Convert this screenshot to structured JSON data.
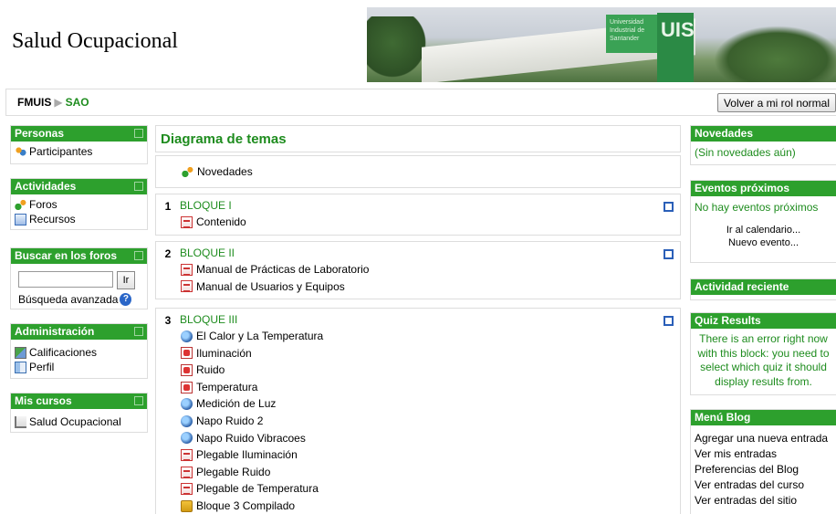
{
  "header": {
    "site_title": "Salud Ocupacional",
    "banner_sign": "Universidad Industrial de Santander",
    "banner_logo": "UIS"
  },
  "navbar": {
    "breadcrumb": [
      {
        "label": "FMUIS"
      },
      {
        "label": "SAO"
      }
    ],
    "separator": "▶",
    "role_button": "Volver a mi rol normal"
  },
  "left": {
    "personas": {
      "title": "Personas",
      "items": [
        {
          "label": "Participantes",
          "icon": "people-icon"
        }
      ]
    },
    "actividades": {
      "title": "Actividades",
      "items": [
        {
          "label": "Foros",
          "icon": "forum-icon"
        },
        {
          "label": "Recursos",
          "icon": "resource-icon"
        }
      ]
    },
    "buscar": {
      "title": "Buscar en los foros",
      "input_value": "",
      "button": "Ir",
      "advanced": "Búsqueda avanzada",
      "help": "?"
    },
    "admin": {
      "title": "Administración",
      "items": [
        {
          "label": "Calificaciones",
          "icon": "grades-icon"
        },
        {
          "label": "Perfil",
          "icon": "profile-icon"
        }
      ]
    },
    "cursos": {
      "title": "Mis cursos",
      "items": [
        {
          "label": "Salud Ocupacional",
          "icon": "course-icon"
        }
      ]
    }
  },
  "main": {
    "title": "Diagrama de temas",
    "news": "Novedades",
    "topics": [
      {
        "num": "1",
        "title": "BLOQUE I",
        "items": [
          {
            "label": "Contenido",
            "icon": "pdf-icon"
          }
        ]
      },
      {
        "num": "2",
        "title": "BLOQUE II",
        "items": [
          {
            "label": "Manual de Prácticas de Laboratorio",
            "icon": "pdf-icon"
          },
          {
            "label": "Manual de Usuarios y Equipos",
            "icon": "pdf-icon"
          }
        ]
      },
      {
        "num": "3",
        "title": "BLOQUE III",
        "items": [
          {
            "label": "El Calor y La Temperatura",
            "icon": "web-icon"
          },
          {
            "label": "Iluminación",
            "icon": "powerpoint-icon"
          },
          {
            "label": "Ruido",
            "icon": "powerpoint-icon"
          },
          {
            "label": "Temperatura",
            "icon": "powerpoint-icon"
          },
          {
            "label": "Medición de Luz",
            "icon": "web-icon"
          },
          {
            "label": "Napo Ruido 2",
            "icon": "web-icon"
          },
          {
            "label": "Napo Ruido Vibracoes",
            "icon": "web-icon"
          },
          {
            "label": "Plegable Iluminación",
            "icon": "pdf-icon"
          },
          {
            "label": "Plegable Ruido",
            "icon": "pdf-icon"
          },
          {
            "label": "Plegable de Temperatura",
            "icon": "pdf-icon"
          },
          {
            "label": "Bloque 3 Compilado",
            "icon": "zip-icon"
          }
        ]
      }
    ]
  },
  "right": {
    "novedades": {
      "title": "Novedades",
      "text": "(Sin novedades aún)"
    },
    "eventos": {
      "title": "Eventos próximos",
      "text": "No hay eventos próximos",
      "link1": "Ir al calendario...",
      "link2": "Nuevo evento..."
    },
    "reciente": {
      "title": "Actividad reciente"
    },
    "quiz": {
      "title": "Quiz Results",
      "text": "There is an error right now with this block: you need to select which quiz it should display results from."
    },
    "blog": {
      "title": "Menú Blog",
      "items": [
        "Agregar una nueva entrada",
        "Ver mis entradas",
        "Preferencias del Blog",
        "Ver entradas del curso",
        "Ver entradas del sitio"
      ]
    }
  },
  "colors": {
    "accent": "#2da02d",
    "link_green": "#1e8c1e"
  }
}
